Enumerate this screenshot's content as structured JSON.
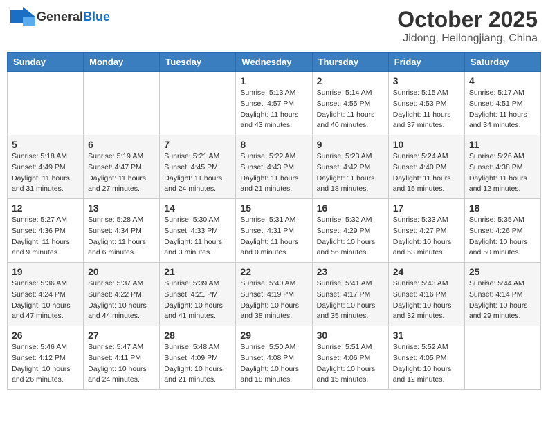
{
  "header": {
    "logo_general": "General",
    "logo_blue": "Blue",
    "month_title": "October 2025",
    "location": "Jidong, Heilongjiang, China"
  },
  "days_of_week": [
    "Sunday",
    "Monday",
    "Tuesday",
    "Wednesday",
    "Thursday",
    "Friday",
    "Saturday"
  ],
  "weeks": [
    [
      {
        "day": "",
        "info": ""
      },
      {
        "day": "",
        "info": ""
      },
      {
        "day": "",
        "info": ""
      },
      {
        "day": "1",
        "info": "Sunrise: 5:13 AM\nSunset: 4:57 PM\nDaylight: 11 hours\nand 43 minutes."
      },
      {
        "day": "2",
        "info": "Sunrise: 5:14 AM\nSunset: 4:55 PM\nDaylight: 11 hours\nand 40 minutes."
      },
      {
        "day": "3",
        "info": "Sunrise: 5:15 AM\nSunset: 4:53 PM\nDaylight: 11 hours\nand 37 minutes."
      },
      {
        "day": "4",
        "info": "Sunrise: 5:17 AM\nSunset: 4:51 PM\nDaylight: 11 hours\nand 34 minutes."
      }
    ],
    [
      {
        "day": "5",
        "info": "Sunrise: 5:18 AM\nSunset: 4:49 PM\nDaylight: 11 hours\nand 31 minutes."
      },
      {
        "day": "6",
        "info": "Sunrise: 5:19 AM\nSunset: 4:47 PM\nDaylight: 11 hours\nand 27 minutes."
      },
      {
        "day": "7",
        "info": "Sunrise: 5:21 AM\nSunset: 4:45 PM\nDaylight: 11 hours\nand 24 minutes."
      },
      {
        "day": "8",
        "info": "Sunrise: 5:22 AM\nSunset: 4:43 PM\nDaylight: 11 hours\nand 21 minutes."
      },
      {
        "day": "9",
        "info": "Sunrise: 5:23 AM\nSunset: 4:42 PM\nDaylight: 11 hours\nand 18 minutes."
      },
      {
        "day": "10",
        "info": "Sunrise: 5:24 AM\nSunset: 4:40 PM\nDaylight: 11 hours\nand 15 minutes."
      },
      {
        "day": "11",
        "info": "Sunrise: 5:26 AM\nSunset: 4:38 PM\nDaylight: 11 hours\nand 12 minutes."
      }
    ],
    [
      {
        "day": "12",
        "info": "Sunrise: 5:27 AM\nSunset: 4:36 PM\nDaylight: 11 hours\nand 9 minutes."
      },
      {
        "day": "13",
        "info": "Sunrise: 5:28 AM\nSunset: 4:34 PM\nDaylight: 11 hours\nand 6 minutes."
      },
      {
        "day": "14",
        "info": "Sunrise: 5:30 AM\nSunset: 4:33 PM\nDaylight: 11 hours\nand 3 minutes."
      },
      {
        "day": "15",
        "info": "Sunrise: 5:31 AM\nSunset: 4:31 PM\nDaylight: 11 hours\nand 0 minutes."
      },
      {
        "day": "16",
        "info": "Sunrise: 5:32 AM\nSunset: 4:29 PM\nDaylight: 10 hours\nand 56 minutes."
      },
      {
        "day": "17",
        "info": "Sunrise: 5:33 AM\nSunset: 4:27 PM\nDaylight: 10 hours\nand 53 minutes."
      },
      {
        "day": "18",
        "info": "Sunrise: 5:35 AM\nSunset: 4:26 PM\nDaylight: 10 hours\nand 50 minutes."
      }
    ],
    [
      {
        "day": "19",
        "info": "Sunrise: 5:36 AM\nSunset: 4:24 PM\nDaylight: 10 hours\nand 47 minutes."
      },
      {
        "day": "20",
        "info": "Sunrise: 5:37 AM\nSunset: 4:22 PM\nDaylight: 10 hours\nand 44 minutes."
      },
      {
        "day": "21",
        "info": "Sunrise: 5:39 AM\nSunset: 4:21 PM\nDaylight: 10 hours\nand 41 minutes."
      },
      {
        "day": "22",
        "info": "Sunrise: 5:40 AM\nSunset: 4:19 PM\nDaylight: 10 hours\nand 38 minutes."
      },
      {
        "day": "23",
        "info": "Sunrise: 5:41 AM\nSunset: 4:17 PM\nDaylight: 10 hours\nand 35 minutes."
      },
      {
        "day": "24",
        "info": "Sunrise: 5:43 AM\nSunset: 4:16 PM\nDaylight: 10 hours\nand 32 minutes."
      },
      {
        "day": "25",
        "info": "Sunrise: 5:44 AM\nSunset: 4:14 PM\nDaylight: 10 hours\nand 29 minutes."
      }
    ],
    [
      {
        "day": "26",
        "info": "Sunrise: 5:46 AM\nSunset: 4:12 PM\nDaylight: 10 hours\nand 26 minutes."
      },
      {
        "day": "27",
        "info": "Sunrise: 5:47 AM\nSunset: 4:11 PM\nDaylight: 10 hours\nand 24 minutes."
      },
      {
        "day": "28",
        "info": "Sunrise: 5:48 AM\nSunset: 4:09 PM\nDaylight: 10 hours\nand 21 minutes."
      },
      {
        "day": "29",
        "info": "Sunrise: 5:50 AM\nSunset: 4:08 PM\nDaylight: 10 hours\nand 18 minutes."
      },
      {
        "day": "30",
        "info": "Sunrise: 5:51 AM\nSunset: 4:06 PM\nDaylight: 10 hours\nand 15 minutes."
      },
      {
        "day": "31",
        "info": "Sunrise: 5:52 AM\nSunset: 4:05 PM\nDaylight: 10 hours\nand 12 minutes."
      },
      {
        "day": "",
        "info": ""
      }
    ]
  ]
}
